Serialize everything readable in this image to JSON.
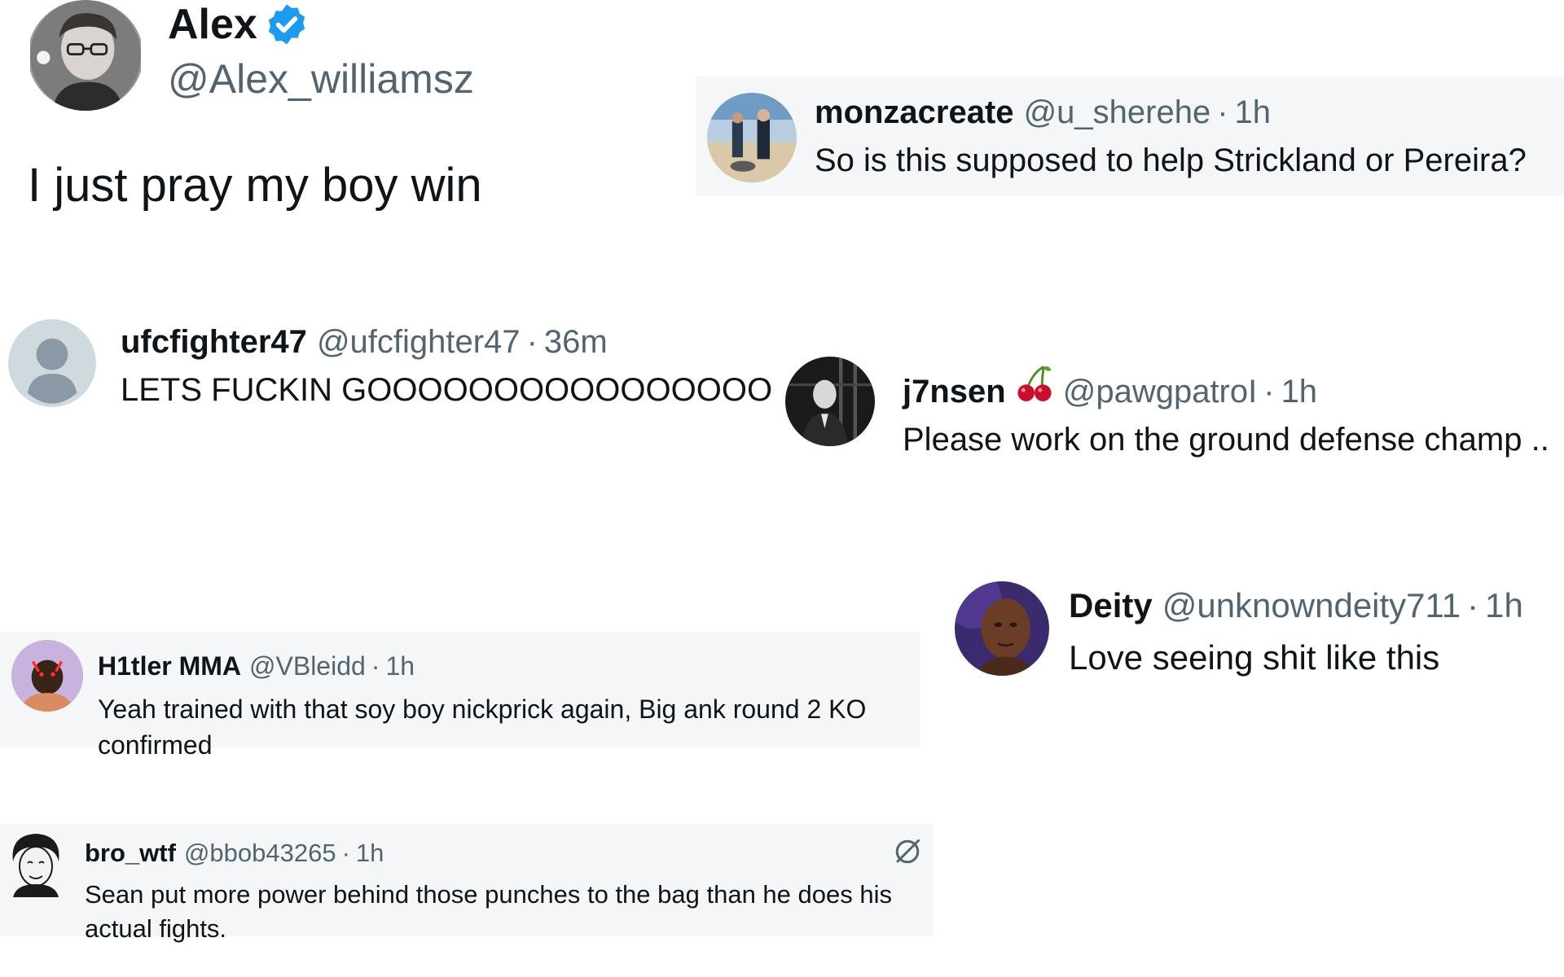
{
  "post": {
    "author_name": "Alex",
    "author_handle": "@Alex_williamsz",
    "text": "I just pray my boy win"
  },
  "replies": [
    {
      "name": "monzacreate",
      "handle": "@u_sherehe",
      "separator": "·",
      "time": "1h",
      "text": "So is this supposed to help Strickland or Pereira?"
    },
    {
      "name": "ufcfighter47",
      "handle": "@ufcfighter47",
      "separator": "·",
      "time": "36m",
      "text": "LETS FUCKIN GOOOOOOOOOOOOOOOO"
    },
    {
      "name": "j7nsen",
      "handle": "@pawgpatroI",
      "separator": "·",
      "time": "1h",
      "text": "Please work on the ground defense champ .."
    },
    {
      "name": "Deity",
      "handle": "@unknowndeity711",
      "separator": "·",
      "time": "1h",
      "text": "Love seeing shit like this"
    },
    {
      "name": "H1tler MMA",
      "handle": "@VBleidd",
      "separator": "·",
      "time": "1h",
      "text": "Yeah trained with that soy boy nickprick again, Big ank round 2 KO confirmed"
    },
    {
      "name": "bro_wtf",
      "handle": "@bbob43265",
      "separator": "·",
      "time": "1h",
      "text": "Sean put more power behind those punches to the bag than he does his actual fights."
    }
  ],
  "icons": {
    "verified": "verified-badge-icon",
    "cherry": "cherry-emoji-icon",
    "grok": "grok-icon"
  },
  "colors": {
    "verified_blue": "#1d9bf0",
    "secondary_text": "#536471",
    "primary_text": "#0f1419",
    "panel_gray": "#f5f6f7"
  }
}
